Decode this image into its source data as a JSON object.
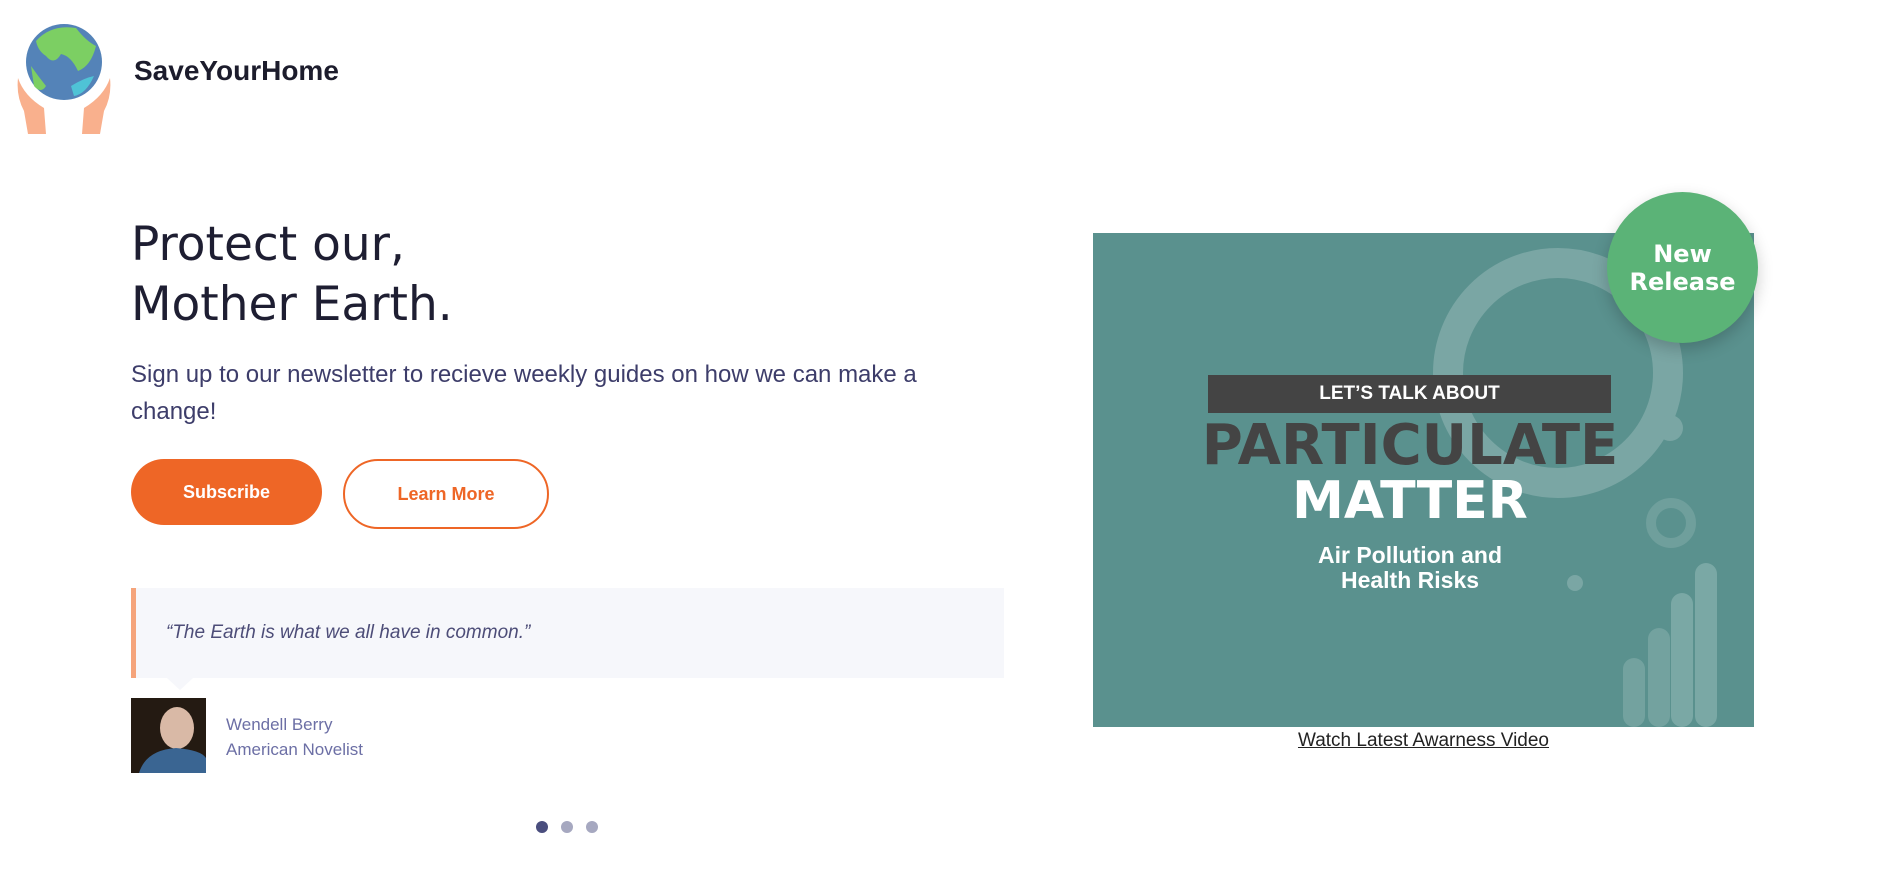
{
  "header": {
    "brand": "SaveYourHome",
    "logo_icon": "globe-in-hands-icon"
  },
  "hero": {
    "title_line1": "Protect our,",
    "title_line2": "Mother Earth.",
    "lead": "Sign up to our newsletter to recieve weekly guides on how we can make a change!",
    "subscribe_label": "Subscribe",
    "learn_more_label": "Learn More"
  },
  "testimonial": {
    "quote": "“The Earth is what we all have in common.”",
    "name": "Wendell Berry",
    "role": "American Novelist",
    "slides": 3,
    "active_slide": 1
  },
  "video": {
    "kicker": "LET’S TALK ABOUT",
    "title1": "PARTICULATE",
    "title2": "MATTER",
    "subtitle1": "Air Pollution and",
    "subtitle2": "Health Risks",
    "badge": "New Release",
    "link": "Watch Latest Awarness Video"
  },
  "colors": {
    "accent": "#ee6626",
    "badge": "#5bb377",
    "video_bg": "#5a918e",
    "dot_active": "#4a4e7e"
  }
}
